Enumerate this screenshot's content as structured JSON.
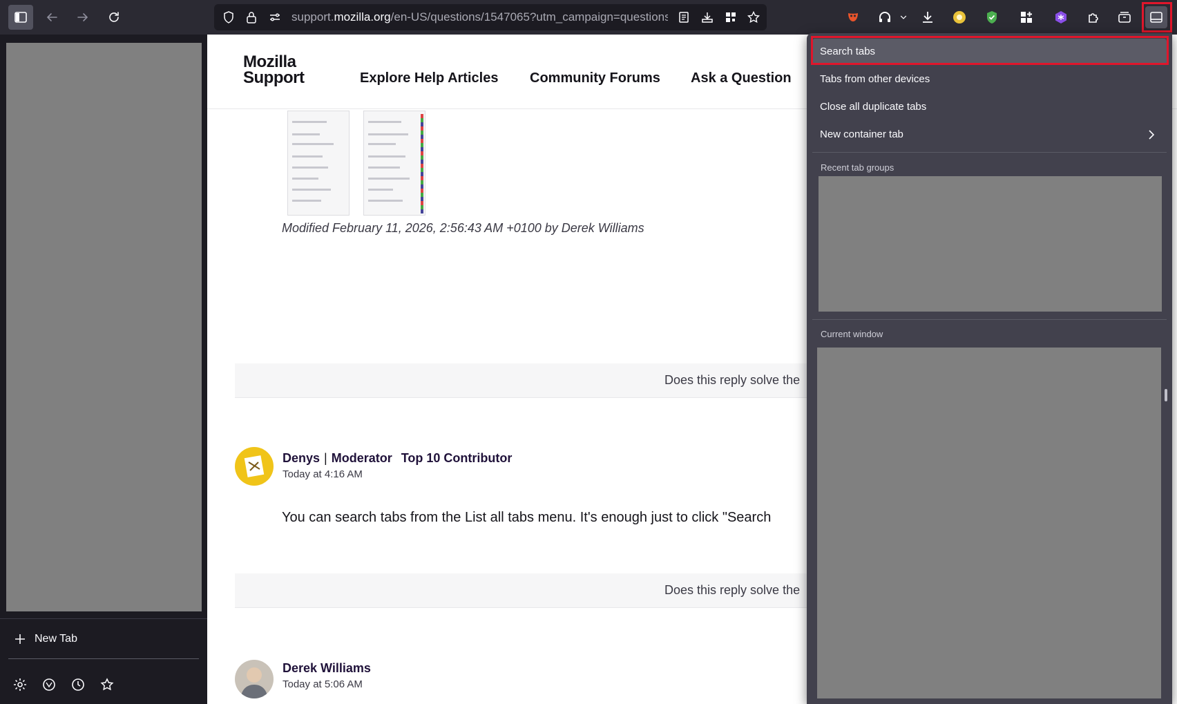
{
  "toolbar": {
    "url_prefix": "support.",
    "url_domain": "mozilla.org",
    "url_rest": "/en-US/questions/1547065?utm_campaign=questions"
  },
  "sidebar": {
    "new_tab_label": "New Tab"
  },
  "site": {
    "logo_line1": "Mozilla",
    "logo_line2": "Support",
    "nav": [
      "Explore Help Articles",
      "Community Forums",
      "Ask a Question"
    ]
  },
  "thread": {
    "modified": "Modified February 11, 2026, 2:56:43 AM +0100 by Derek Williams",
    "helpful_prompt": "Does this reply solve the",
    "posts": [
      {
        "author": "Denys",
        "role": "Moderator",
        "badge": "Top 10 Contributor",
        "time": "Today at 4:16 AM",
        "text": "You can search tabs from the List all tabs menu. It's enough just to click \"Search"
      },
      {
        "author": "Derek Williams",
        "time": "Today at 5:06 AM"
      }
    ]
  },
  "tabs_menu": {
    "items": [
      "Search tabs",
      "Tabs from other devices",
      "Close all duplicate tabs",
      "New container tab"
    ],
    "recent_groups_heading": "Recent tab groups",
    "current_window_heading": "Current window"
  },
  "colors": {
    "toolbar_bg": "#2b2a33",
    "panel_bg": "#42414d",
    "highlight": "#e0162b",
    "placeholder_grey": "#808080"
  },
  "icons": [
    "sidebar-toggle-icon",
    "back-arrow-icon",
    "forward-arrow-icon",
    "reload-icon",
    "shield-icon",
    "lock-icon",
    "permissions-icon",
    "reader-view-icon",
    "save-page-icon",
    "qr-code-icon",
    "bookmark-star-icon",
    "mask-extension-icon",
    "headphones-icon",
    "chevron-down-icon",
    "downloads-icon",
    "coin-extension-icon",
    "shield-check-icon",
    "apps-grid-icon",
    "purple-extension-icon",
    "puzzle-icon",
    "container-icon",
    "list-all-tabs-icon",
    "plus-icon",
    "gear-icon",
    "ai-chatbot-icon",
    "history-clock-icon",
    "star-icon",
    "chevron-right-icon"
  ]
}
